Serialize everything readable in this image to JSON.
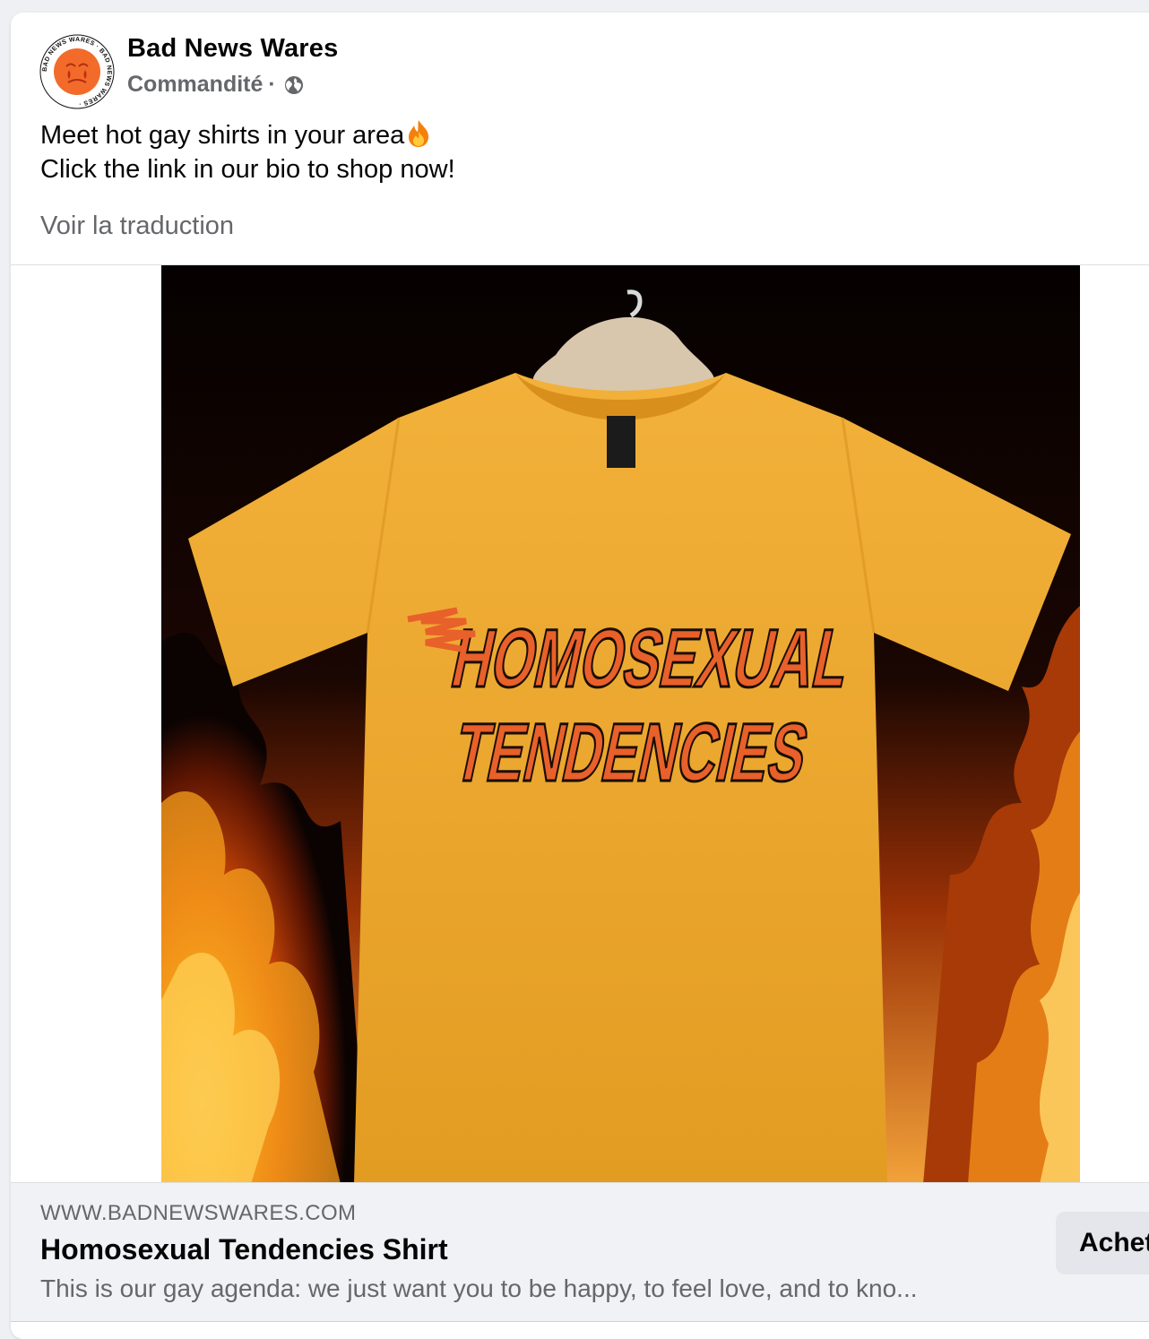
{
  "post": {
    "page_name": "Bad News Wares",
    "sponsored_label": "Commandité",
    "separator": "·",
    "privacy_icon": "globe-icon",
    "text_line1": "Meet hot gay shirts in your area",
    "text_emoji": "fire-emoji",
    "text_line2": "Click the link in our bio to shop now!",
    "see_translation": "Voir la traduction"
  },
  "avatar": {
    "ring_text": "BAD NEWS WARES · BAD NEWS WARES ·",
    "face_color": "#f26b2b"
  },
  "media": {
    "shirt_print_line1": "HOMOSEXUAL",
    "shirt_print_line2": "TENDENCIES",
    "shirt_color": "#f0a52c",
    "print_color": "#e8602a"
  },
  "link_preview": {
    "domain": "WWW.BADNEWSWARES.COM",
    "title": "Homosexual Tendencies Shirt",
    "description": "This is our gay agenda: we just want you to be happy, to feel love, and to kno...",
    "cta_label": "Achet"
  }
}
